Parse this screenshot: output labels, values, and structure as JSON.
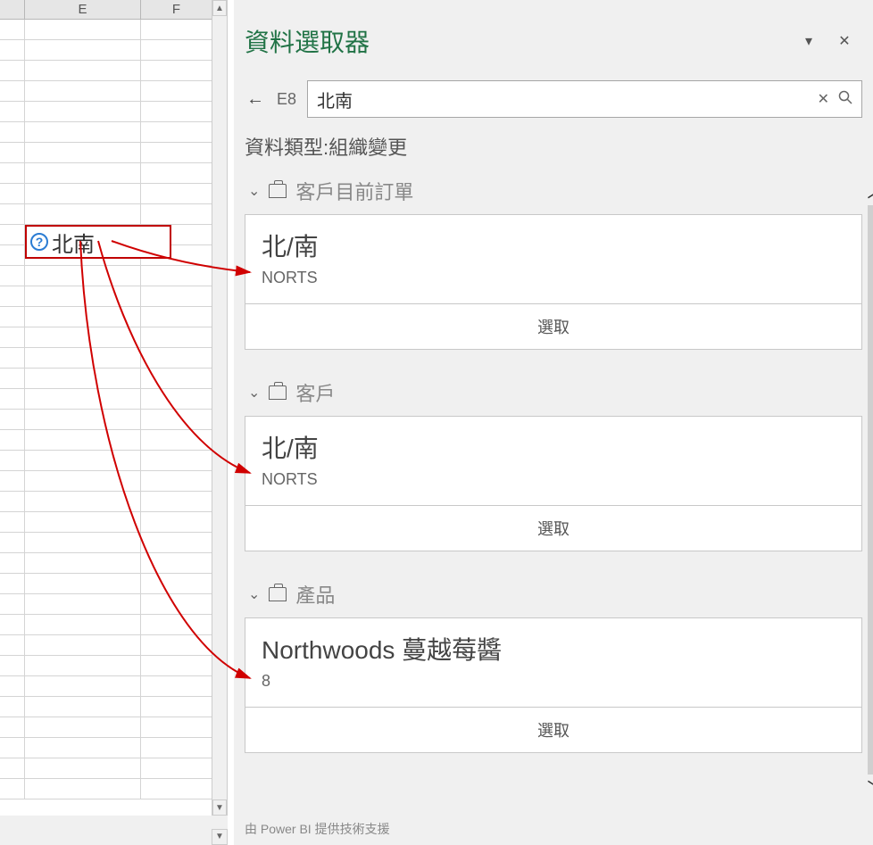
{
  "sheet": {
    "col_e": "E",
    "col_f": "F",
    "active_cell_text": "北南"
  },
  "panel": {
    "title": "資料選取器",
    "cell_ref": "E8",
    "search_value": "北南",
    "subtitle": "資料類型:組織變更",
    "groups": [
      {
        "label": "客戶目前訂單",
        "title": "北/南",
        "sub": "NORTS",
        "select": "選取"
      },
      {
        "label": "客戶",
        "title": "北/南",
        "sub": "NORTS",
        "select": "選取"
      },
      {
        "label": "產品",
        "title": "Northwoods 蔓越莓醬",
        "sub": "8",
        "select": "選取"
      }
    ],
    "footer": "由 Power BI 提供技術支援"
  }
}
